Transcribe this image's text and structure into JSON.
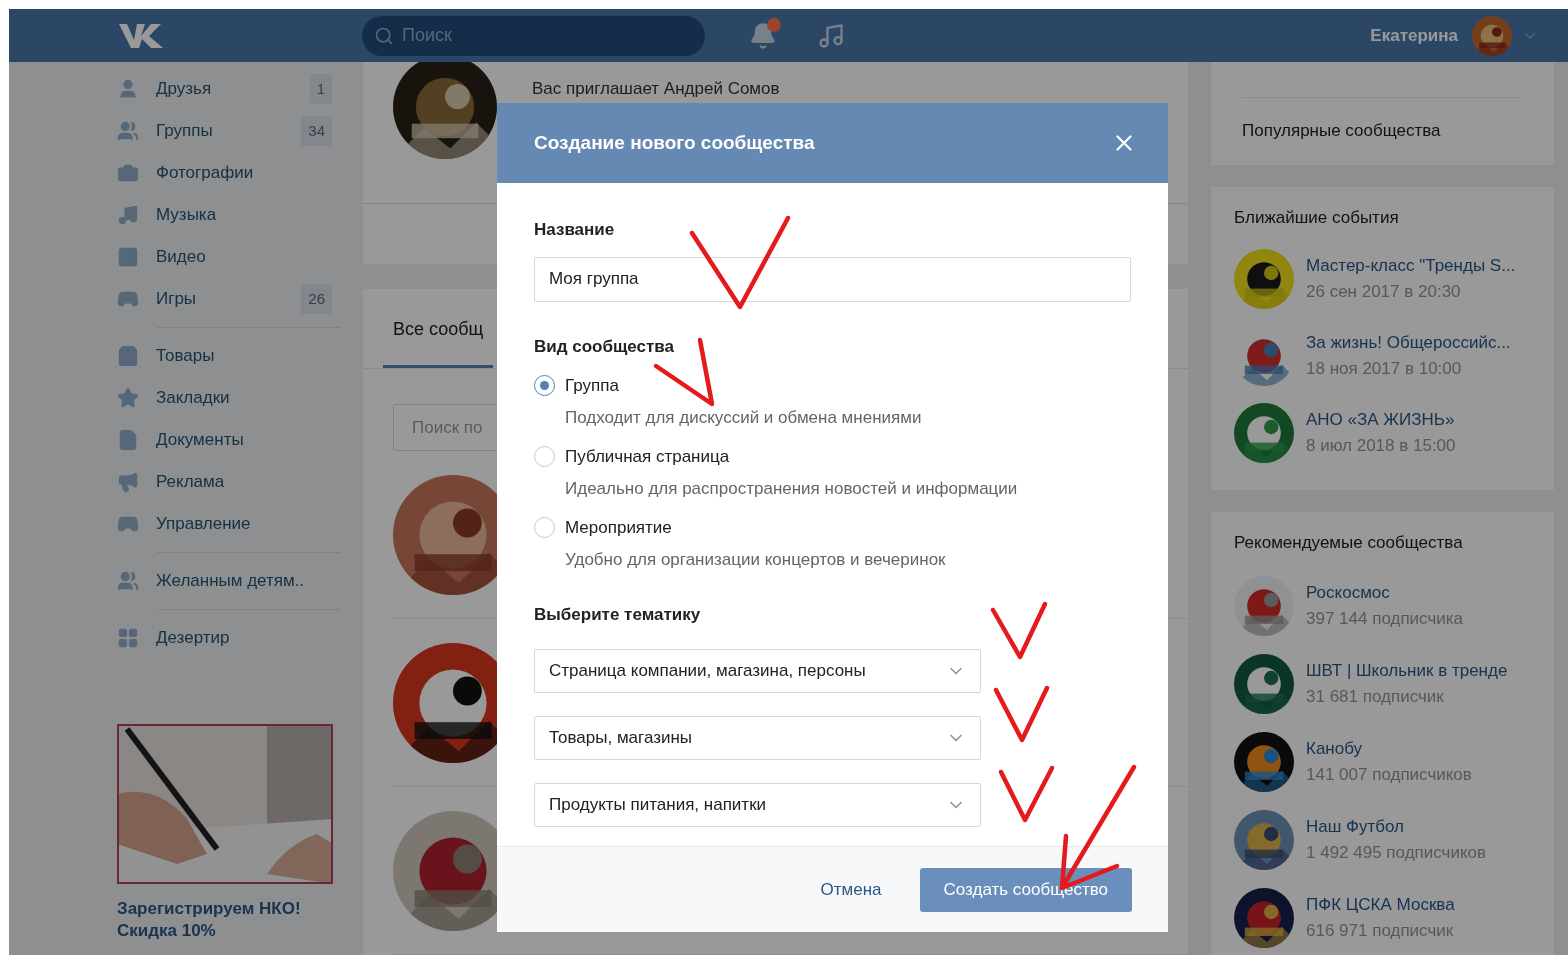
{
  "header": {
    "search_placeholder": "Поиск",
    "user_name": "Екатерина"
  },
  "sidebar": {
    "sections": [
      {
        "items": [
          {
            "label": "Друзья",
            "count": "1"
          },
          {
            "label": "Группы",
            "count": "34"
          },
          {
            "label": "Фотографии"
          },
          {
            "label": "Музыка"
          },
          {
            "label": "Видео"
          },
          {
            "label": "Игры",
            "count": "26"
          }
        ]
      },
      {
        "items": [
          {
            "label": "Товары"
          },
          {
            "label": "Закладки"
          },
          {
            "label": "Документы"
          },
          {
            "label": "Реклама"
          },
          {
            "label": "Управление"
          }
        ]
      },
      {
        "items": [
          {
            "label": "Желанным детям.."
          }
        ]
      },
      {
        "items": [
          {
            "label": "Дезертир"
          }
        ]
      }
    ],
    "ad": {
      "title": "Зарегистрируем НКО!",
      "subtitle": "Скидка 10%"
    }
  },
  "main": {
    "invite": {
      "subtitle": "Вас приглашает Андрей Сомов"
    },
    "tab": "Все сообщ",
    "search_placeholder": "Поиск по"
  },
  "right": {
    "links": [
      "Популярные сообщества"
    ],
    "events": {
      "title": "Ближайшие события",
      "items": [
        {
          "name": "Мастер-класс \"Тренды S...",
          "date": "26 сен 2017 в 20:30"
        },
        {
          "name": "За жизнь! Общероссийс...",
          "date": "18 ноя 2017 в 10:00"
        },
        {
          "name": "АНО «ЗА ЖИЗНЬ»",
          "date": "8 июл 2018 в 15:00"
        }
      ]
    },
    "recommended": {
      "title": "Рекомендуемые сообщества",
      "items": [
        {
          "name": "Роскосмос",
          "followers": "397 144 подписчика"
        },
        {
          "name": "ШВТ | Школьник в тренде",
          "followers": "31 681 подписчик"
        },
        {
          "name": "Канобу",
          "followers": "141 007 подписчиков"
        },
        {
          "name": "Наш Футбол",
          "followers": "1 492 495 подписчиков"
        },
        {
          "name": "ПФК ЦСКА Москва",
          "followers": "616 971 подписчик"
        }
      ]
    }
  },
  "modal": {
    "title": "Создание нового сообщества",
    "name_label": "Название",
    "name_value": "Моя группа",
    "type_label": "Вид сообщества",
    "types": [
      {
        "label": "Группа",
        "description": "Подходит для дискуссий и обмена мнениями",
        "selected": true
      },
      {
        "label": "Публичная страница",
        "description": "Идеально для распространения новостей и информации",
        "selected": false
      },
      {
        "label": "Мероприятие",
        "description": "Удобно для организации концертов и вечеринок",
        "selected": false
      }
    ],
    "topic_label": "Выберите тематику",
    "topics": [
      "Страница компании, магазина, персоны",
      "Товары, магазины",
      "Продукты питания, напитки"
    ],
    "cancel": "Отмена",
    "submit": "Создать сообщество"
  }
}
